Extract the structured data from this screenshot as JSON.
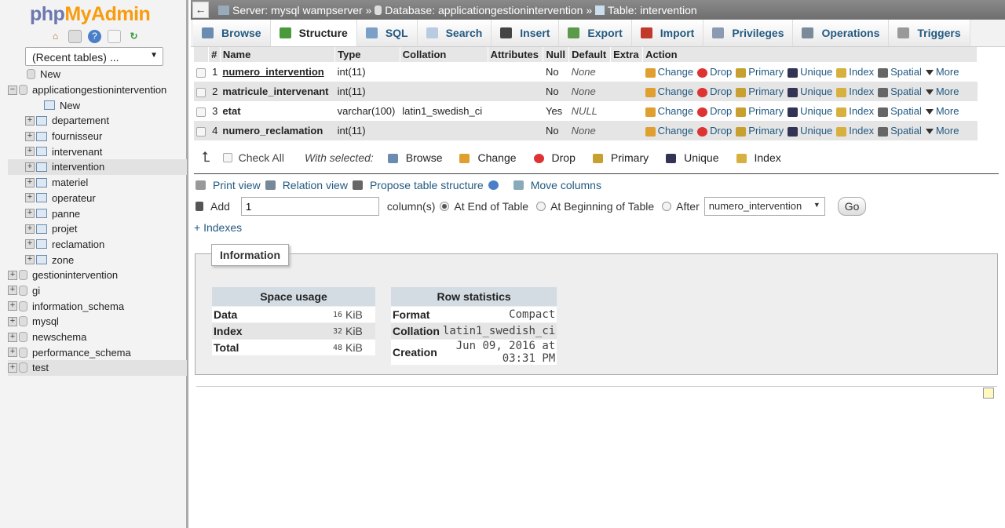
{
  "sidebar": {
    "logo_php": "php",
    "logo_myadmin": "MyAdmin",
    "nav_icons": [
      "home-icon",
      "logout-icon",
      "help-icon",
      "docs-icon",
      "reload-icon"
    ],
    "recent_tables": "(Recent tables) ...",
    "tree": [
      {
        "label": "New",
        "level": 0,
        "kind": "new-db"
      },
      {
        "label": "applicationgestionintervention",
        "level": 0,
        "kind": "db",
        "expanded": true
      },
      {
        "label": "New",
        "level": 1,
        "kind": "new-table"
      },
      {
        "label": "departement",
        "level": 1,
        "kind": "table"
      },
      {
        "label": "fournisseur",
        "level": 1,
        "kind": "table"
      },
      {
        "label": "intervenant",
        "level": 1,
        "kind": "table"
      },
      {
        "label": "intervention",
        "level": 1,
        "kind": "table",
        "selected": true
      },
      {
        "label": "materiel",
        "level": 1,
        "kind": "table"
      },
      {
        "label": "operateur",
        "level": 1,
        "kind": "table"
      },
      {
        "label": "panne",
        "level": 1,
        "kind": "table"
      },
      {
        "label": "projet",
        "level": 1,
        "kind": "table"
      },
      {
        "label": "reclamation",
        "level": 1,
        "kind": "table"
      },
      {
        "label": "zone",
        "level": 1,
        "kind": "table"
      },
      {
        "label": "gestionintervention",
        "level": 0,
        "kind": "db"
      },
      {
        "label": "gi",
        "level": 0,
        "kind": "db"
      },
      {
        "label": "information_schema",
        "level": 0,
        "kind": "db"
      },
      {
        "label": "mysql",
        "level": 0,
        "kind": "db"
      },
      {
        "label": "newschema",
        "level": 0,
        "kind": "db"
      },
      {
        "label": "performance_schema",
        "level": 0,
        "kind": "db"
      },
      {
        "label": "test",
        "level": 0,
        "kind": "db",
        "selected": true
      }
    ]
  },
  "breadcrumb": {
    "server": "Server: mysql wampserver",
    "database": "Database: applicationgestionintervention",
    "table": "Table: intervention",
    "sep": "»"
  },
  "tabs": [
    {
      "label": "Browse",
      "color": "#6b8cb0"
    },
    {
      "label": "Structure",
      "active": true,
      "color": "#4a9a3c"
    },
    {
      "label": "SQL",
      "color": "#7aa0c8"
    },
    {
      "label": "Search",
      "color": "#b8cbe0"
    },
    {
      "label": "Insert",
      "color": "#444"
    },
    {
      "label": "Export",
      "color": "#5a9a4a"
    },
    {
      "label": "Import",
      "color": "#c0392b"
    },
    {
      "label": "Privileges",
      "color": "#8a9ab0"
    },
    {
      "label": "Operations",
      "color": "#7a8a9a"
    },
    {
      "label": "Triggers",
      "color": "#999"
    }
  ],
  "structure": {
    "headers": [
      "#",
      "Name",
      "Type",
      "Collation",
      "Attributes",
      "Null",
      "Default",
      "Extra",
      "Action"
    ],
    "rows": [
      {
        "num": "1",
        "name": "numero_intervention",
        "primary": true,
        "type": "int(11)",
        "collation": "",
        "attributes": "",
        "null": "No",
        "default": "None",
        "extra": ""
      },
      {
        "num": "2",
        "name": "matricule_intervenant",
        "type": "int(11)",
        "collation": "",
        "attributes": "",
        "null": "No",
        "default": "None",
        "extra": ""
      },
      {
        "num": "3",
        "name": "etat",
        "type": "varchar(100)",
        "collation": "latin1_swedish_ci",
        "attributes": "",
        "null": "Yes",
        "default": "NULL",
        "extra": ""
      },
      {
        "num": "4",
        "name": "numero_reclamation",
        "type": "int(11)",
        "collation": "",
        "attributes": "",
        "null": "No",
        "default": "None",
        "extra": ""
      }
    ],
    "actions": [
      "Change",
      "Drop",
      "Primary",
      "Unique",
      "Index",
      "Spatial",
      "More"
    ]
  },
  "with_selected": {
    "check_all": "Check All",
    "label": "With selected:",
    "actions": [
      "Browse",
      "Change",
      "Drop",
      "Primary",
      "Unique",
      "Index"
    ]
  },
  "tools": {
    "print_view": "Print view",
    "relation_view": "Relation view",
    "propose": "Propose table structure",
    "move_columns": "Move columns"
  },
  "add": {
    "label": "Add",
    "count": "1",
    "columns": "column(s)",
    "at_end": "At End of Table",
    "at_begin": "At Beginning of Table",
    "after": "After",
    "after_select": "numero_intervention",
    "go": "Go"
  },
  "indexes": "+ Indexes",
  "information": {
    "legend": "Information",
    "space": {
      "title": "Space usage",
      "rows": [
        {
          "label": "Data",
          "value": "16",
          "unit": "KiB"
        },
        {
          "label": "Index",
          "value": "32",
          "unit": "KiB"
        },
        {
          "label": "Total",
          "value": "48",
          "unit": "KiB"
        }
      ]
    },
    "rowstats": {
      "title": "Row statistics",
      "rows": [
        {
          "label": "Format",
          "value": "Compact"
        },
        {
          "label": "Collation",
          "value": "latin1_swedish_ci"
        },
        {
          "label": "Creation",
          "value": "Jun 09, 2016 at 03:31 PM"
        }
      ]
    }
  }
}
